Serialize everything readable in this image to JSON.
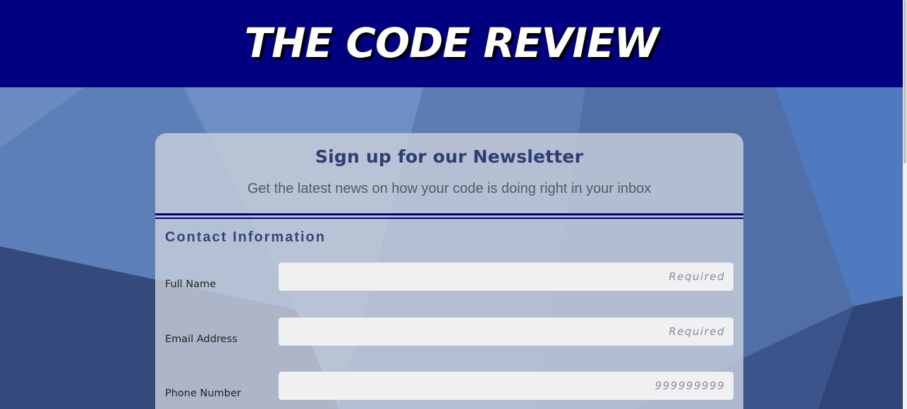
{
  "header": {
    "site_title": "THE CODE REVIEW"
  },
  "newsletter": {
    "title": "Sign up for our Newsletter",
    "subtitle": "Get the latest news on how your code is doing right in your inbox"
  },
  "contact_section": {
    "heading": "Contact Information",
    "fields": [
      {
        "label": "Full Name",
        "placeholder": "Required",
        "value": ""
      },
      {
        "label": "Email Address",
        "placeholder": "Required",
        "value": ""
      },
      {
        "label": "Phone Number",
        "placeholder": "999999999",
        "value": ""
      }
    ]
  },
  "colors": {
    "header_bg": "#000080",
    "accent_navy": "#000080",
    "heading_text": "#2d3e73",
    "card_bg": "#c8ceda"
  }
}
